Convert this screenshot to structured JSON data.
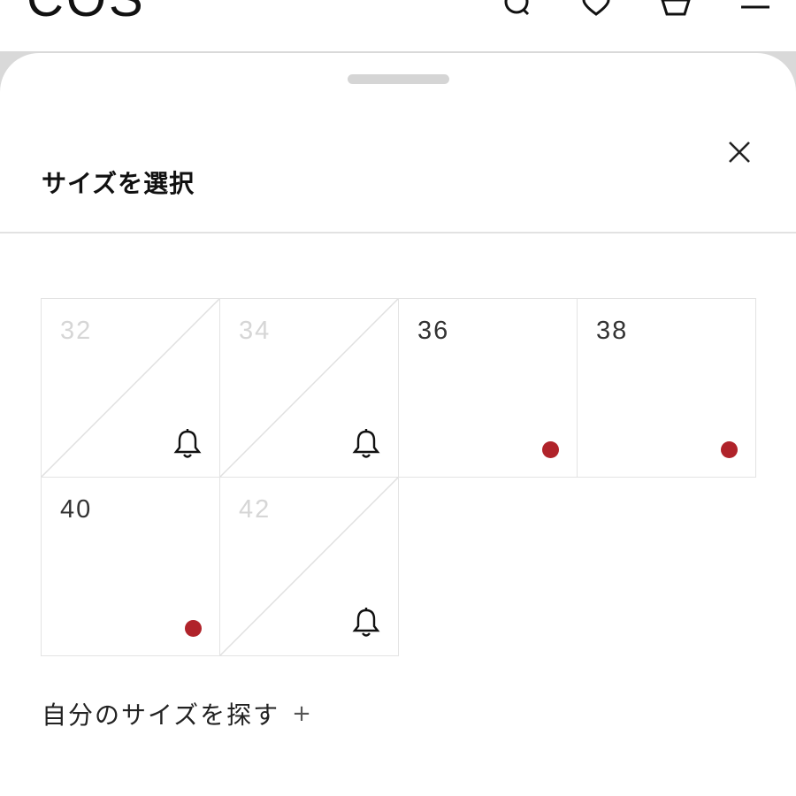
{
  "header": {
    "logo": "COS",
    "icons": [
      "search-icon",
      "heart-icon",
      "bag-icon",
      "menu-icon"
    ]
  },
  "sheet": {
    "title": "サイズを選択",
    "close_icon": "close-icon",
    "sizes": [
      {
        "label": "32",
        "available": false,
        "indicator": "bell-icon"
      },
      {
        "label": "34",
        "available": false,
        "indicator": "bell-icon"
      },
      {
        "label": "36",
        "available": true,
        "indicator": "dot"
      },
      {
        "label": "38",
        "available": true,
        "indicator": "dot"
      },
      {
        "label": "40",
        "available": true,
        "indicator": "dot"
      },
      {
        "label": "42",
        "available": false,
        "indicator": "bell-icon"
      }
    ],
    "find_size_label": "自分のサイズを探す",
    "find_size_plus": "+"
  },
  "colors": {
    "available_dot": "#b0232a",
    "soldout_text": "#d6d6d6",
    "border": "#e3e3e3"
  }
}
